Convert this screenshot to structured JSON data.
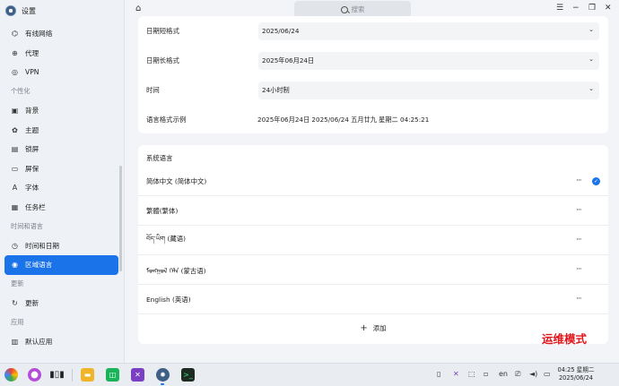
{
  "app": {
    "title": "设置"
  },
  "search": {
    "placeholder": "搜索"
  },
  "sidebar": {
    "items": [
      {
        "label": "有线网络",
        "icon": "ethernet-icon"
      },
      {
        "label": "代理",
        "icon": "proxy-icon"
      },
      {
        "label": "VPN",
        "icon": "vpn-icon"
      }
    ],
    "section_personalization": "个性化",
    "personalization_items": [
      {
        "label": "背景",
        "icon": "background-icon"
      },
      {
        "label": "主题",
        "icon": "theme-icon"
      },
      {
        "label": "锁屏",
        "icon": "lock-screen-icon"
      },
      {
        "label": "屏保",
        "icon": "screensaver-icon"
      },
      {
        "label": "字体",
        "icon": "font-icon"
      },
      {
        "label": "任务栏",
        "icon": "taskbar-icon"
      }
    ],
    "section_time_language": "时间和语言",
    "time_items": [
      {
        "label": "时间和日期",
        "icon": "clock-icon"
      },
      {
        "label": "区域语言",
        "icon": "region-language-icon",
        "active": true
      }
    ],
    "section_update": "更新",
    "update_items": [
      {
        "label": "更新",
        "icon": "update-icon"
      }
    ],
    "section_apps": "应用",
    "app_items": [
      {
        "label": "默认应用",
        "icon": "default-apps-icon"
      }
    ]
  },
  "format": {
    "short_date_label": "日期短格式",
    "short_date_value": "2025/06/24",
    "long_date_label": "日期长格式",
    "long_date_value": "2025年06月24日",
    "time_label": "时间",
    "time_value": "24小时制",
    "sample_label": "语言格式示例",
    "sample_value": "2025年06月24日  2025/06/24  五月廿九  星期二  04:25:21"
  },
  "system_language": {
    "title": "系统语言",
    "languages": [
      {
        "name": "简体中文 (简体中文)",
        "selected": true
      },
      {
        "name": "繁體(繁体)",
        "selected": false
      },
      {
        "name": "བོད་ཡིག (藏语)",
        "selected": false
      },
      {
        "name": "ᠮᠣᠩᠭᠣᠯ ᠬᠡᠯᠡ (蒙古语)",
        "selected": false
      },
      {
        "name": "English (英语)",
        "selected": false
      }
    ],
    "add_label": "添加"
  },
  "overlay": {
    "ops_mode": "运维模式"
  },
  "taskbar": {
    "time": "04:25 星期二",
    "date": "2025/06/24",
    "input_method": "en"
  },
  "colors": {
    "accent": "#1a73e8",
    "ops_mode": "#e0151a"
  }
}
